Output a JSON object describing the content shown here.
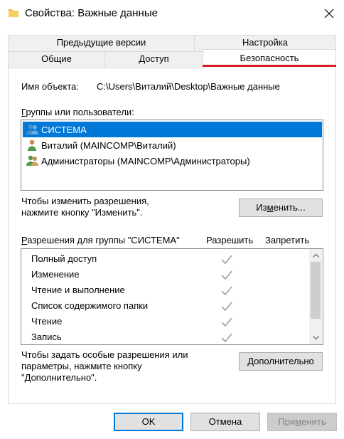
{
  "window": {
    "title": "Свойства: Важные данные",
    "close_glyph": "✕"
  },
  "tabs": {
    "previous_versions": "Предыдущие версии",
    "settings": "Настройка",
    "general": "Общие",
    "access": "Доступ",
    "security": "Безопасность"
  },
  "security": {
    "object_label": "Имя объекта:",
    "object_path": "C:\\Users\\Виталий\\Desktop\\Важные данные",
    "groups_label_pre": "Г",
    "groups_label_rest": "руппы или пользователи:",
    "groups": [
      {
        "name": "СИСТЕМА",
        "icon": "users-group-icon",
        "selected": true
      },
      {
        "name": "Виталий (MAINCOMP\\Виталий)",
        "icon": "user-icon",
        "selected": false
      },
      {
        "name": "Администраторы (MAINCOMP\\Администраторы)",
        "icon": "users-group-icon",
        "selected": false
      }
    ],
    "change_hint_line1": "Чтобы изменить разрешения,",
    "change_hint_line2": "нажмите кнопку \"Изменить\".",
    "change_button_pre": "Из",
    "change_button_u": "м",
    "change_button_rest": "енить...",
    "permissions_label_pre": "Р",
    "permissions_label_rest": "азрешения для группы \"СИСТЕМА\"",
    "allow_header": "Разрешить",
    "deny_header": "Запретить",
    "permissions": [
      {
        "name": "Полный доступ",
        "allow": true,
        "deny": false
      },
      {
        "name": "Изменение",
        "allow": true,
        "deny": false
      },
      {
        "name": "Чтение и выполнение",
        "allow": true,
        "deny": false
      },
      {
        "name": "Список содержимого папки",
        "allow": true,
        "deny": false
      },
      {
        "name": "Чтение",
        "allow": true,
        "deny": false
      },
      {
        "name": "Запись",
        "allow": true,
        "deny": false
      }
    ],
    "advanced_hint_line1": "Чтобы задать особые разрешения или",
    "advanced_hint_line2": "параметры, нажмите кнопку",
    "advanced_hint_line3": "\"Дополнительно\".",
    "advanced_button_pre": "Д",
    "advanced_button_u": "о",
    "advanced_button_rest": "полнительно"
  },
  "footer": {
    "ok": "OK",
    "cancel": "Отмена",
    "apply_pre": "При",
    "apply_u": "м",
    "apply_rest": "енить"
  },
  "colors": {
    "selection": "#0078d7",
    "tab_accent": "#d61f26",
    "check_gray": "#a0a0a0"
  }
}
